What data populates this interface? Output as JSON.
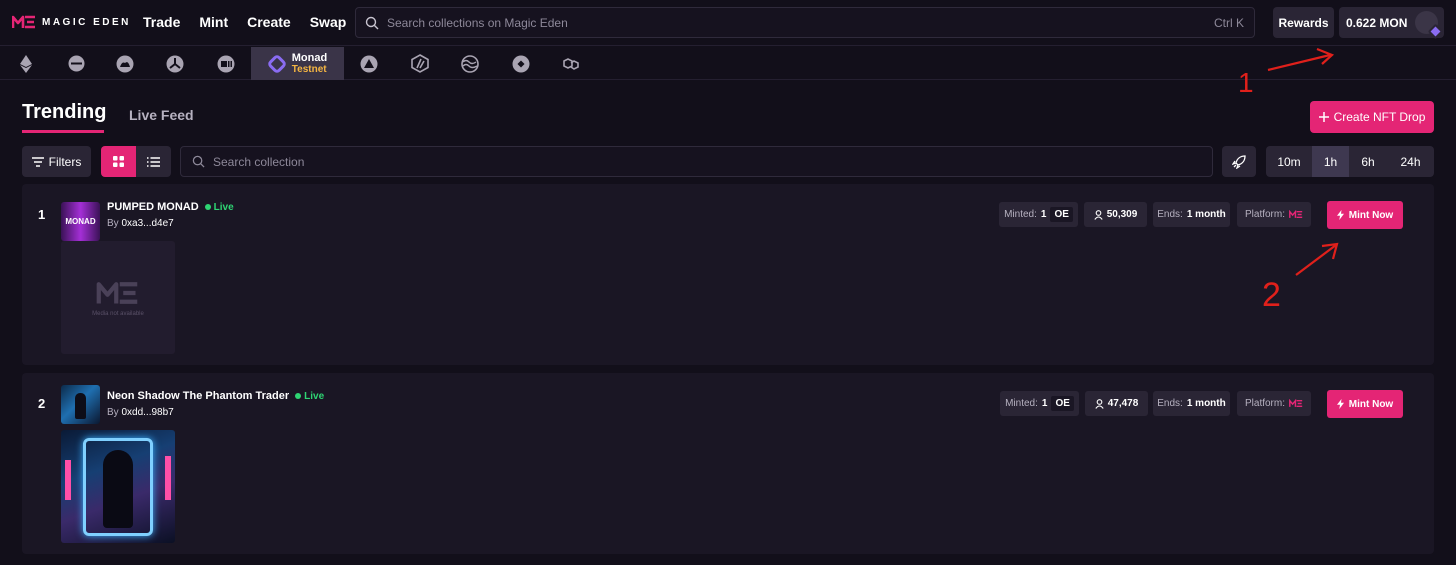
{
  "header": {
    "logo_text": "MAGIC EDEN",
    "nav": [
      "Trade",
      "Mint",
      "Create",
      "Swap"
    ],
    "search_placeholder": "Search collections on Magic Eden",
    "search_shortcut": "Ctrl  K",
    "rewards_label": "Rewards",
    "wallet_balance": "0.622 MON"
  },
  "chains": {
    "active": {
      "name": "Monad",
      "sub": "Testnet"
    },
    "icons": [
      "ethereum-icon",
      "base-icon",
      "berachain-icon",
      "apechain-icon",
      "abstract-icon",
      "avalanche-icon",
      "arbitrum-icon",
      "sei-icon",
      "bnb-icon",
      "polygon-icon"
    ]
  },
  "tabs": {
    "trending": "Trending",
    "live_feed": "Live Feed"
  },
  "create_drop_label": "Create NFT Drop",
  "toolbar": {
    "filters_label": "Filters",
    "collection_search_placeholder": "Search collection",
    "time_options": [
      "10m",
      "1h",
      "6h",
      "24h"
    ],
    "time_selected": "1h"
  },
  "collections": [
    {
      "rank": "1",
      "name": "PUMPED MONAD",
      "status": "Live",
      "creator_prefix": "By",
      "creator": "0xa3...d4e7",
      "thumb_text": "MONAD",
      "media_placeholder": "Media not available",
      "minted_label": "Minted:",
      "minted_value": "1",
      "minted_type": "OE",
      "minters": "50,309",
      "ends_label": "Ends:",
      "ends_value": "1 month",
      "platform_label": "Platform:",
      "mint_label": "Mint Now"
    },
    {
      "rank": "2",
      "name": "Neon Shadow The Phantom Trader",
      "status": "Live",
      "creator_prefix": "By",
      "creator": "0xdd...98b7",
      "minted_label": "Minted:",
      "minted_value": "1",
      "minted_type": "OE",
      "minters": "47,478",
      "ends_label": "Ends:",
      "ends_value": "1 month",
      "platform_label": "Platform:",
      "mint_label": "Mint Now"
    }
  ],
  "annotations": {
    "label_1": "1",
    "label_2": "2",
    "color": "#e0201b"
  },
  "colors": {
    "accent": "#e42575",
    "live": "#2ed573",
    "testnet": "#f5b642",
    "background": "#120f1a"
  }
}
